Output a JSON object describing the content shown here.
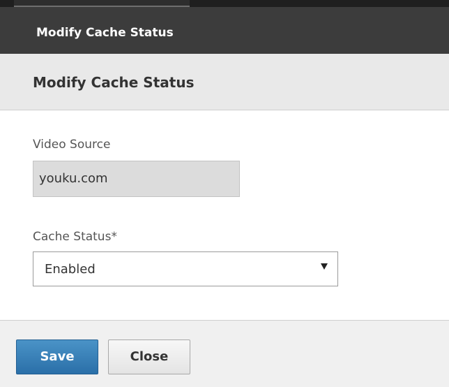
{
  "window": {
    "title": "Modify Cache Status"
  },
  "section": {
    "title": "Modify Cache Status"
  },
  "form": {
    "video_source": {
      "label": "Video Source",
      "value": "youku.com"
    },
    "cache_status": {
      "label": "Cache Status*",
      "selected": "Enabled"
    }
  },
  "footer": {
    "save_label": "Save",
    "close_label": "Close"
  },
  "colors": {
    "title_bar": "#3c3c3c",
    "section_header": "#e9e9e9",
    "save_button": "#2a6fa8",
    "readonly_field": "#dcdcdc"
  },
  "icons": {
    "dropdown": "chevron-down-icon"
  }
}
